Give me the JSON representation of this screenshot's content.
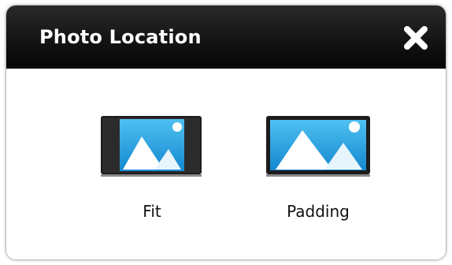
{
  "dialog": {
    "title": "Photo Location",
    "close_icon": "close-x-icon"
  },
  "options": {
    "fit": {
      "label": "Fit",
      "icon": "photo-fit-icon"
    },
    "padding": {
      "label": "Padding",
      "icon": "photo-padding-icon"
    }
  },
  "colors": {
    "titlebar": "#111111",
    "title_text": "#ffffff",
    "icon_sky": "#1e9fe0",
    "frame": "#1a1a1a"
  }
}
